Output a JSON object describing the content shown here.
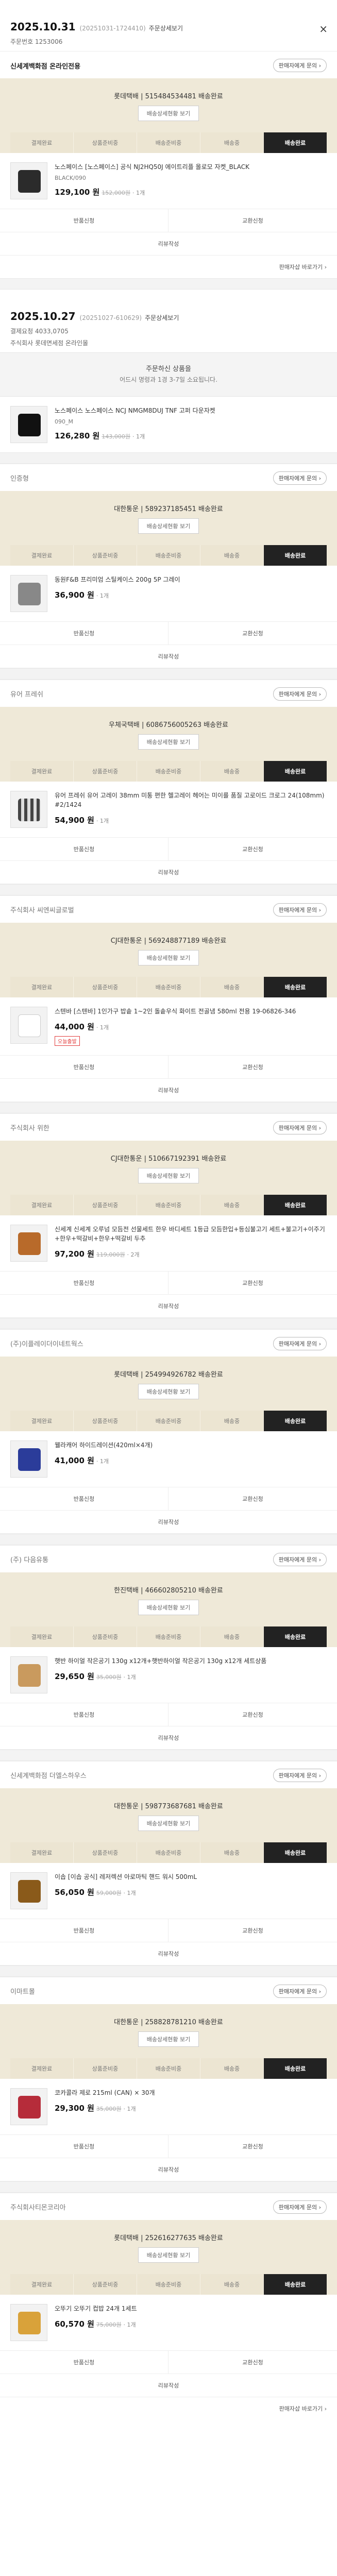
{
  "orders": [
    {
      "date": "2025.10.31",
      "meta": "(20251031-1724410)",
      "detail_label": "주문상세보기",
      "close": "×",
      "order_no": "주문번호 1253006",
      "seller": "신세계백화점 온라인전용",
      "seller_style": "bold",
      "ask_label": "판매자에게 문의 ›",
      "ship_title": "롯데택배 | 515484534481 배송완료",
      "ship_btn": "배송상세현황 보기",
      "steps": [
        "결제완료",
        "상품준비중",
        "배송준비중",
        "배송중",
        "배송완료"
      ],
      "active_step": 4,
      "item": {
        "name": "노스페이스 [노스페이스] 공식 NJ2HQ50J 에이트리플 올로모 자켓_BLACK",
        "option": "BLACK/090",
        "price": "129,100 원",
        "orig": "152,000원",
        "qty": "· 1개",
        "badge": "",
        "thumb": "t-jacket"
      },
      "actions": [
        "반품신청",
        "교환신청",
        "리뷰작성"
      ],
      "foot": "판매자샵 바로가기 ›"
    },
    {
      "date": "2025.10.27",
      "meta": "(20251027-610629)",
      "detail_label": "주문상세보기",
      "close": "",
      "order_no": "결제요청 4033,0705",
      "order_sub": "주식회사 롯데면세점 온라인몰",
      "notice_title": "주문하신 상품을",
      "notice_body": "어드시 명령과 1경 3-7일 소요됩니다.",
      "seller": "",
      "ship_title": "",
      "item": {
        "name": "노스페이스 노스페이스 NCJ NMGM8DUJ TNF 고퍼 다운자켓",
        "option": "090_M",
        "price": "126,280 원",
        "orig": "143,000원",
        "qty": "· 1개",
        "badge": "",
        "thumb": "t-black"
      },
      "foot": ""
    },
    {
      "seller": "인증형",
      "seller_style": "gray",
      "ask_label": "판매자에게 문의 ›",
      "ship_title": "대한통운 | 589237185451 배송완료",
      "ship_btn": "배송상세현황 보기",
      "steps": [
        "결제완료",
        "상품준비중",
        "배송준비중",
        "배송중",
        "배송완료"
      ],
      "active_step": 4,
      "item": {
        "name": "동원F&B 프리미엄 스틸케이스 200g 5P 그레이",
        "option": "",
        "price": "36,900 원",
        "orig": "",
        "qty": "· 1개",
        "badge": "",
        "thumb": "t-gray"
      },
      "actions": [
        "반품신청",
        "교환신청",
        "리뷰작성"
      ],
      "foot": ""
    },
    {
      "seller": "유어 프레쉬",
      "seller_style": "gray",
      "ask_label": "판매자에게 문의 ›",
      "ship_title": "우체국택배 | 6086756005263 배송완료",
      "ship_btn": "배송상세현황 보기",
      "steps": [
        "결제완료",
        "상품준비중",
        "배송준비중",
        "배송중",
        "배송완료"
      ],
      "active_step": 4,
      "item": {
        "name": "유어 프레쉬 유어 고레이 38mm 미통 편한 헬고레이 헤어는 미이를 품질 고로이드 크로그 24(108mm) #2/1424",
        "option": "",
        "price": "54,900 원",
        "orig": "",
        "qty": "· 1개",
        "badge": "",
        "thumb": "t-stripe"
      },
      "actions": [
        "반품신청",
        "교환신청",
        "리뷰작성"
      ],
      "foot": ""
    },
    {
      "seller": "주식회사 씨엔씨글로벌",
      "seller_style": "gray",
      "ask_label": "판매자에게 문의 ›",
      "ship_title": "CJ대한통운 | 569248877189 배송완료",
      "ship_btn": "배송상세현황 보기",
      "steps": [
        "결제완료",
        "상품준비중",
        "배송준비중",
        "배송중",
        "배송완료"
      ],
      "active_step": 4,
      "item": {
        "name": "스텐바 [스텐바] 1인가구 밥솥 1~2인 돌솥우식 화이트 전골냄 580ml 전용 19-06826-346",
        "option": "",
        "price": "44,000 원",
        "orig": "",
        "qty": "· 1개",
        "badge": "오늘출발",
        "thumb": "t-white"
      },
      "actions": [
        "반품신청",
        "교환신청",
        "리뷰작성"
      ],
      "foot": ""
    },
    {
      "seller": "주식회사 위한",
      "seller_style": "gray",
      "ask_label": "판매자에게 문의 ›",
      "ship_title": "CJ대한통운 | 510667192391 배송완료",
      "ship_btn": "배송상세현황 보기",
      "steps": [
        "결제완료",
        "상품준비중",
        "배송준비중",
        "배송중",
        "배송완료"
      ],
      "active_step": 4,
      "item": {
        "name": "신세계 신세계 오루넘 모듬전 선물세트 한우 바디세트 1등급 모듬한입+등심불고기 세트+불고기+이주기+한우+떡갈비+한우+떡갈비 두추",
        "option": "",
        "price": "97,200 원",
        "orig": "119,000원",
        "qty": "· 2개",
        "badge": "",
        "thumb": "t-food"
      },
      "actions": [
        "반품신청",
        "교환신청",
        "리뷰작성"
      ],
      "foot": ""
    },
    {
      "seller": "(주)이플레이더이네트웍스",
      "seller_style": "gray",
      "ask_label": "판매자에게 문의 ›",
      "ship_title": "롯데택배 | 254994926782 배송완료",
      "ship_btn": "배송상세현황 보기",
      "steps": [
        "결제완료",
        "상품준비중",
        "배송준비중",
        "배송중",
        "배송완료"
      ],
      "active_step": 4,
      "item": {
        "name": "웰라캐어 하이드레이션(420ml×4개)",
        "option": "",
        "price": "41,000 원",
        "orig": "",
        "qty": "· 1개",
        "badge": "",
        "thumb": "t-blue"
      },
      "actions": [
        "반품신청",
        "교환신청",
        "리뷰작성"
      ],
      "foot": ""
    },
    {
      "seller": "(주) 다음유통",
      "seller_style": "gray",
      "ask_label": "판매자에게 문의 ›",
      "ship_title": "한진택배 | 466602805210 배송완료",
      "ship_btn": "배송상세현황 보기",
      "steps": [
        "결제완료",
        "상품준비중",
        "배송준비중",
        "배송중",
        "배송완료"
      ],
      "active_step": 4,
      "item": {
        "name": "햇반 하이얼 작은공기 130g x12개+햇반하이얼 작은공기 130g x12개 세트상품",
        "option": "",
        "price": "29,650 원",
        "orig": "35,000원",
        "qty": "· 1개",
        "badge": "",
        "thumb": "t-wood"
      },
      "actions": [
        "반품신청",
        "교환신청",
        "리뷰작성"
      ],
      "foot": ""
    },
    {
      "seller": "신세계백화점 더엘스하우스",
      "seller_style": "gray",
      "ask_label": "판매자에게 문의 ›",
      "ship_title": "대한통운 | 598773687681 배송완료",
      "ship_btn": "배송상세현황 보기",
      "steps": [
        "결제완료",
        "상품준비중",
        "배송준비중",
        "배송중",
        "배송완료"
      ],
      "active_step": 4,
      "item": {
        "name": "이솝 [이솝 공식] 레저렉션 아로마틱 핸드 워시 500mL",
        "option": "",
        "price": "56,050 원",
        "orig": "59,000원",
        "qty": "· 1개",
        "badge": "",
        "thumb": "t-amber"
      },
      "actions": [
        "반품신청",
        "교환신청",
        "리뷰작성"
      ],
      "foot": ""
    },
    {
      "seller": "이마트몰",
      "seller_style": "gray",
      "ask_label": "판매자에게 문의 ›",
      "ship_title": "대한통운 | 258828781210 배송완료",
      "ship_btn": "배송상세현황 보기",
      "steps": [
        "결제완료",
        "상품준비중",
        "배송준비중",
        "배송중",
        "배송완료"
      ],
      "active_step": 4,
      "item": {
        "name": "코카콜라 제로 215ml (CAN) × 30개",
        "option": "",
        "price": "29,300 원",
        "orig": "35,000원",
        "qty": "· 1개",
        "badge": "",
        "thumb": "t-red"
      },
      "actions": [
        "반품신청",
        "교환신청",
        "리뷰작성"
      ],
      "foot": ""
    },
    {
      "seller": "주식회사티몬코리아",
      "seller_style": "gray",
      "ask_label": "판매자에게 문의 ›",
      "ship_title": "롯데택배 | 252616277635 배송완료",
      "ship_btn": "배송상세현황 보기",
      "steps": [
        "결제완료",
        "상품준비중",
        "배송준비중",
        "배송중",
        "배송완료"
      ],
      "active_step": 4,
      "item": {
        "name": "오뚜기 오뚜기 컵밥 24개 1세트",
        "option": "",
        "price": "60,570 원",
        "orig": "75,000원",
        "qty": "· 1개",
        "badge": "",
        "thumb": "t-gold"
      },
      "actions": [
        "반품신청",
        "교환신청",
        "리뷰작성"
      ],
      "foot": "판매자샵 바로가기 ›"
    }
  ]
}
